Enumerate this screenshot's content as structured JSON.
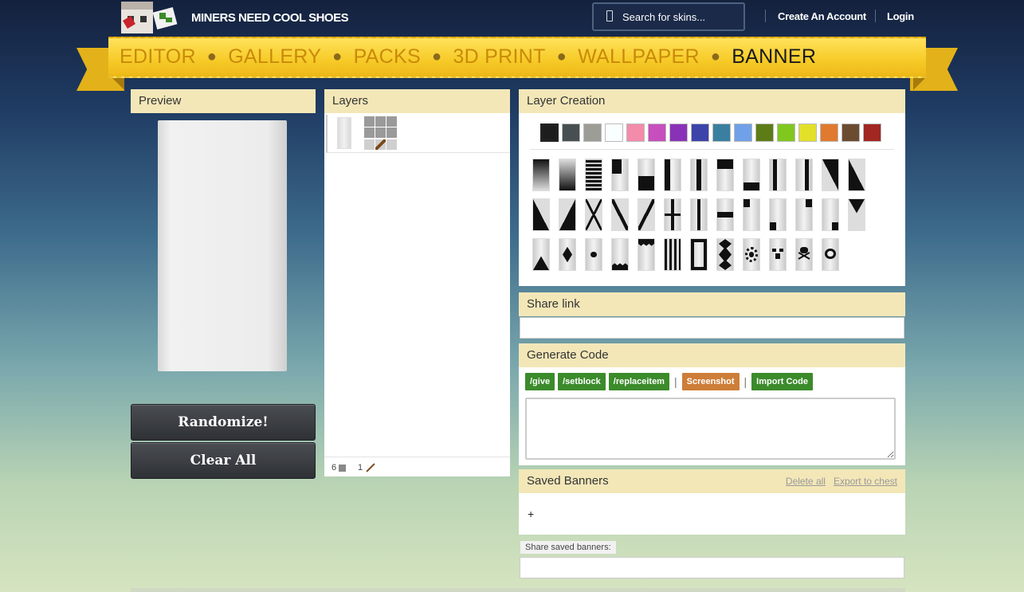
{
  "header": {
    "brand": "MINERS NEED COOL SHOES",
    "search_placeholder": "Search for skins...",
    "create_account": "Create An Account",
    "login": "Login"
  },
  "nav": {
    "items": [
      "EDITOR",
      "GALLERY",
      "PACKS",
      "3D PRINT",
      "WALLPAPER",
      "BANNER"
    ],
    "active": "BANNER"
  },
  "preview": {
    "title": "Preview",
    "randomize_label": "Randomize!",
    "clear_label": "Clear All"
  },
  "layers": {
    "title": "Layers",
    "footer_count_a": "6",
    "footer_count_b": "1"
  },
  "layer_creation": {
    "title": "Layer Creation",
    "colors": [
      "#1d1d1d",
      "#474f52",
      "#9d9d97",
      "#f9fffe",
      "#f38baa",
      "#c74ebd",
      "#8932b8",
      "#3c44aa",
      "#3a7fa0",
      "#6fa0e8",
      "#5e7c16",
      "#80c71f",
      "#e3e02a",
      "#e07a2e",
      "#6b4c31",
      "#a02722"
    ],
    "selected_color": "#1d1d1d",
    "pattern_count": 39
  },
  "share_link": {
    "title": "Share link",
    "value": ""
  },
  "generate_code": {
    "title": "Generate Code",
    "buttons": [
      "/give",
      "/setblock",
      "/replaceitem",
      "Screenshot",
      "Import Code"
    ]
  },
  "saved_banners": {
    "title": "Saved Banners",
    "delete_all": "Delete all",
    "export": "Export to chest",
    "add": "+",
    "share_label": "Share saved banners:"
  }
}
